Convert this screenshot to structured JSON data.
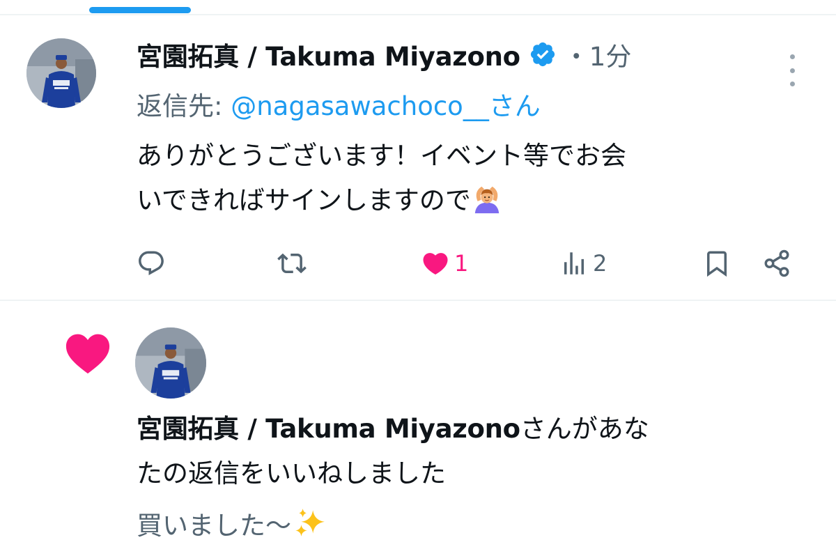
{
  "tweet": {
    "display_name": "宮園拓真 / Takuma Miyazono",
    "time": "・1分",
    "reply_prefix": "返信先: ",
    "reply_handle": "@nagasawachoco__さん",
    "text_line1": "ありがとうございます！イベント等でお会",
    "text_line2": "いできればサインしますので",
    "emoji": "person-gesturing-ok",
    "actions": {
      "like_count": "1",
      "views_count": "2"
    }
  },
  "notification": {
    "liker_name": "宮園拓真 / Takuma Miyazono",
    "text_suffix": "さんがあな",
    "text_line2": "たの返信をいいねしました",
    "quoted_text": "買いました〜",
    "quoted_emoji": "sparkles"
  },
  "colors": {
    "accent": "#1d9bf0",
    "like": "#f91880",
    "secondary_text": "#536471"
  }
}
